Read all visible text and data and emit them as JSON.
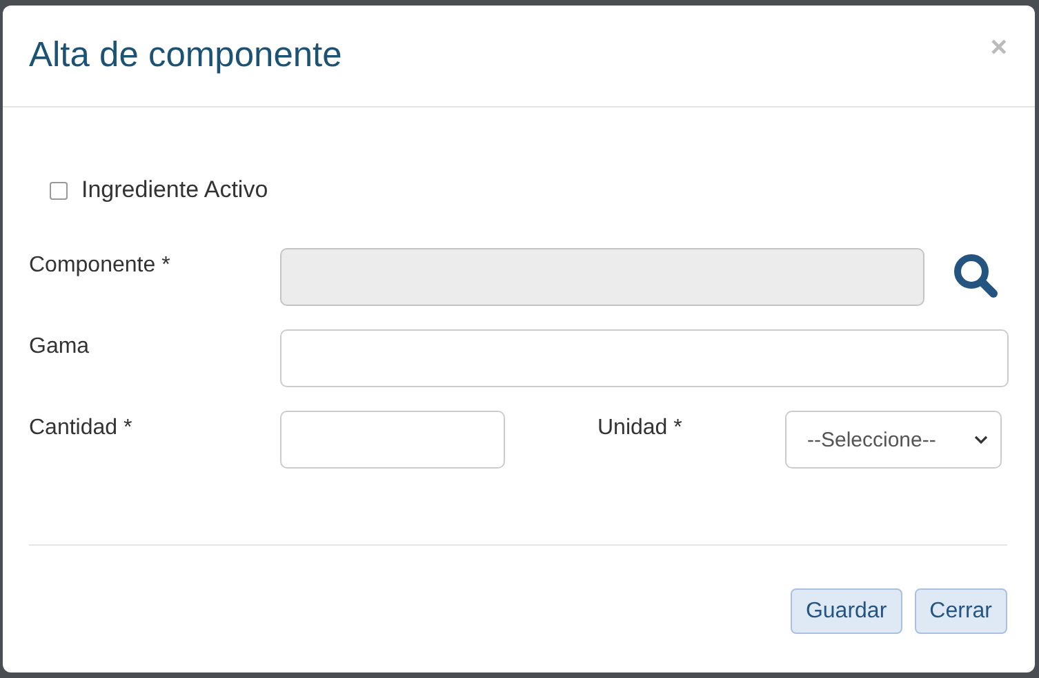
{
  "dialog": {
    "title": "Alta de componente",
    "close": "×"
  },
  "active_ingredient": {
    "label": "Ingrediente Activo",
    "checked": false
  },
  "component": {
    "label": "Componente *",
    "disabled": true
  },
  "range": {
    "label": "Gama"
  },
  "quantity": {
    "label": "Cantidad *"
  },
  "unit": {
    "label": "Unidad *",
    "value": "--Seleccione--"
  },
  "buttons": [
    {
      "label": "Guardar"
    },
    {
      "label": "Cerrar"
    }
  ]
}
